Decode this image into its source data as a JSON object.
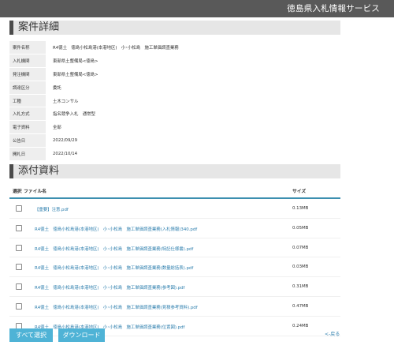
{
  "header": {
    "brand": "徳島県入札情報サービス"
  },
  "section_detail": {
    "title": "案件詳細"
  },
  "details": [
    {
      "label": "案件名称",
      "value": "R4徳土　徳島小松島港(本港地区)　小･小松島　施工単価調査業務"
    },
    {
      "label": "入札機関",
      "value": "東部県土整備局<徳島>"
    },
    {
      "label": "発注機関",
      "value": "東部県土整備局<徳島>"
    },
    {
      "label": "調達区分",
      "value": "委託"
    },
    {
      "label": "工種",
      "value": "土木コンサル"
    },
    {
      "label": "入札方式",
      "value": "指名競争入札　通常型"
    },
    {
      "label": "電子資料",
      "value": "全部"
    },
    {
      "label": "公告日",
      "value": "2022/09/29"
    },
    {
      "label": "開札日",
      "value": "2022/10/14"
    }
  ],
  "section_files": {
    "title": "添付資料"
  },
  "files_table": {
    "headers": {
      "select": "選択",
      "name": "ファイル名",
      "size": "サイズ"
    },
    "rows": [
      {
        "name": "【重要】注意.pdf",
        "size": "0.13MB"
      },
      {
        "name": "R4徳土　徳島小松島港(本港地区)　小･小松島　施工単価調査業務(入札情報)340.pdf",
        "size": "0.05MB"
      },
      {
        "name": "R4徳土　徳島小松島港(本港地区)　小･小松島　施工単価調査業務(特記仕様書).pdf",
        "size": "0.07MB"
      },
      {
        "name": "R4徳土　徳島小松島港(本港地区)　小･小松島　施工単価調査業務(数量総括表).pdf",
        "size": "0.03MB"
      },
      {
        "name": "R4徳土　徳島小松島港(本港地区)　小･小松島　施工単価調査業務(参考図).pdf",
        "size": "0.31MB"
      },
      {
        "name": "R4徳土　徳島小松島港(本港地区)　小･小松島　施工単価調査業務(見積参考資料).pdf",
        "size": "0.47MB"
      },
      {
        "name": "R4徳土　徳島小松島港(本港地区)　小･小松島　施工単価調査業務(位置図).pdf",
        "size": "0.24MB"
      }
    ]
  },
  "actions": {
    "select_all": "すべて選択",
    "download": "ダウンロード",
    "back": "<-戻る"
  }
}
